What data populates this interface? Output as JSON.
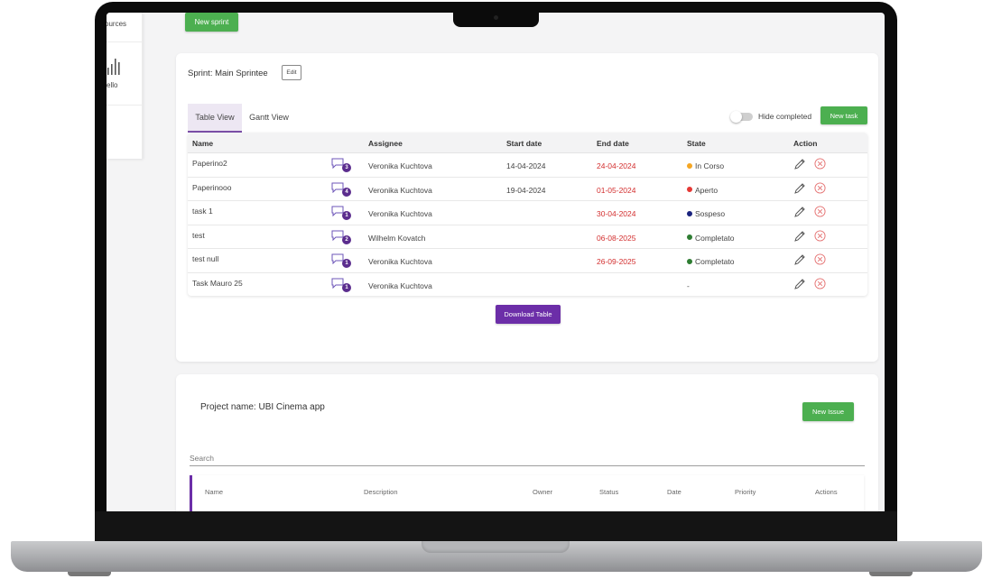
{
  "sidebar": {
    "items": [
      {
        "label": "ources"
      },
      {
        "label": "ello",
        "icon": "bar-chart-icon"
      }
    ]
  },
  "header": {
    "new_sprint_label": "New sprint"
  },
  "sprint": {
    "title": "Sprint: Main Sprintee",
    "edit_label": "Edit",
    "tabs": [
      {
        "label": "Table View",
        "active": true
      },
      {
        "label": "Gantt View",
        "active": false
      }
    ],
    "hide_completed_label": "Hide completed",
    "hide_completed_on": false,
    "new_task_label": "New task",
    "columns": [
      "Name",
      "Assignee",
      "Start date",
      "End date",
      "State",
      "Action"
    ],
    "tasks": [
      {
        "name": "Paperino2",
        "comments": "3",
        "assignee": "Veronika Kuchtova",
        "start": "14-04-2024",
        "end": "24-04-2024",
        "state": "In Corso",
        "state_color": "#f5a623"
      },
      {
        "name": "Paperinooo",
        "comments": "4",
        "assignee": "Veronika Kuchtova",
        "start": "19-04-2024",
        "end": "01-05-2024",
        "state": "Aperto",
        "state_color": "#e53935"
      },
      {
        "name": "task 1",
        "comments": "1",
        "assignee": "Veronika Kuchtova",
        "start": "",
        "end": "30-04-2024",
        "state": "Sospeso",
        "state_color": "#1a237e"
      },
      {
        "name": "test",
        "comments": "2",
        "assignee": "Wilhelm Kovatch",
        "start": "",
        "end": "06-08-2025",
        "state": "Completato",
        "state_color": "#2e7d32"
      },
      {
        "name": "test null",
        "comments": "1",
        "assignee": "Veronika Kuchtova",
        "start": "",
        "end": "26-09-2025",
        "state": "Completato",
        "state_color": "#2e7d32"
      },
      {
        "name": "Task Mauro 25",
        "comments": "1",
        "assignee": "Veronika Kuchtova",
        "start": "",
        "end": "",
        "state": "-",
        "state_color": ""
      }
    ],
    "download_label": "Download Table"
  },
  "project": {
    "title": "Project name: UBI Cinema app",
    "new_issue_label": "New Issue",
    "search_placeholder": "Search",
    "columns": [
      "Name",
      "Description",
      "Owner",
      "Status",
      "Date",
      "Priority",
      "Actions"
    ]
  },
  "colors": {
    "accent": "#6c2ea8",
    "primary_button": "#4caf50",
    "date_overdue": "#d32f2f"
  }
}
